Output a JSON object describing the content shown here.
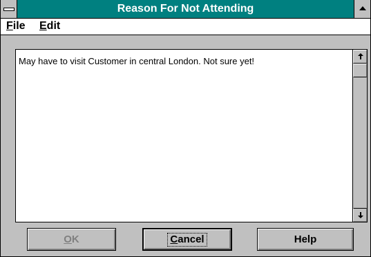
{
  "window": {
    "title": "Reason For Not Attending"
  },
  "menu": {
    "file_mnemonic": "F",
    "file_rest": "ile",
    "edit_mnemonic": "E",
    "edit_rest": "dit"
  },
  "textarea": {
    "value": "May have to visit Customer in central London. Not sure yet!"
  },
  "buttons": {
    "ok_mnemonic": "O",
    "ok_rest": "K",
    "cancel_mnemonic": "C",
    "cancel_rest": "ancel",
    "help": "Help"
  },
  "colors": {
    "titlebar": "#008080",
    "face": "#c0c0c0"
  }
}
